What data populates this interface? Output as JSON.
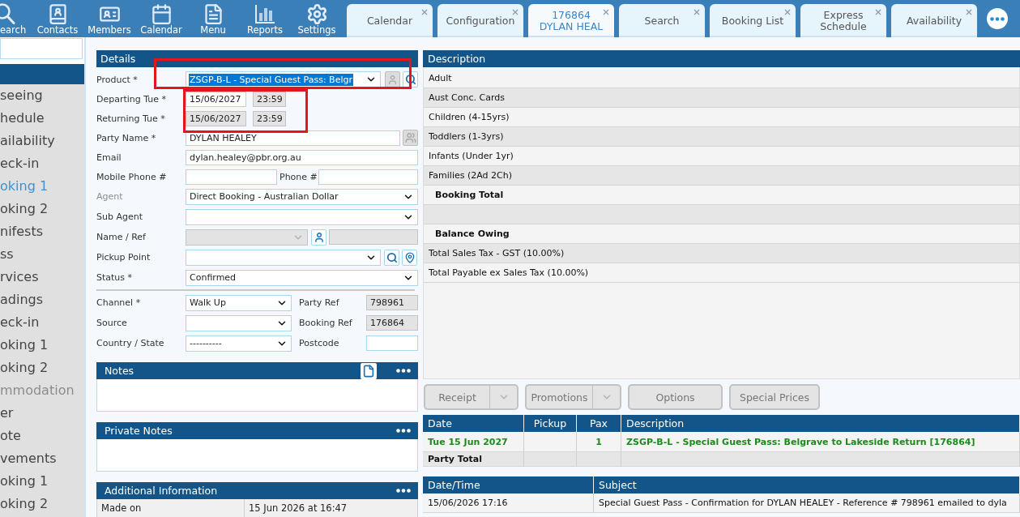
{
  "toolbar": [
    {
      "kind": "search",
      "label": "earch"
    },
    {
      "kind": "contacts",
      "label": "Contacts"
    },
    {
      "kind": "members",
      "label": "Members"
    },
    {
      "kind": "calendar",
      "label": "Calendar"
    },
    {
      "kind": "menu",
      "label": "Menu"
    },
    {
      "kind": "reports",
      "label": "Reports"
    },
    {
      "kind": "settings",
      "label": "Settings"
    }
  ],
  "tabs": [
    {
      "label": "Calendar",
      "selected": false
    },
    {
      "label": "Configuration",
      "selected": false
    },
    {
      "label": "176864 DYLAN HEAL",
      "selected": true
    },
    {
      "label": "Search",
      "selected": false
    },
    {
      "label": "Booking List",
      "selected": false
    },
    {
      "label": "Express Schedule",
      "selected": false
    },
    {
      "label": "Availability",
      "selected": false
    }
  ],
  "sidebar": {
    "items": [
      {
        "label": "seeing",
        "selected": false,
        "disabled": false
      },
      {
        "label": "hedule",
        "selected": false,
        "disabled": false
      },
      {
        "label": "ailability",
        "selected": false,
        "disabled": false
      },
      {
        "label": "eck-in",
        "selected": false,
        "disabled": false
      },
      {
        "label": "oking 1",
        "selected": true,
        "disabled": false
      },
      {
        "label": "oking 2",
        "selected": false,
        "disabled": false
      },
      {
        "label": "nifests",
        "selected": false,
        "disabled": false
      },
      {
        "label": "ss",
        "selected": false,
        "disabled": false
      },
      {
        "label": "rvices",
        "selected": false,
        "disabled": false
      },
      {
        "label": "adings",
        "selected": false,
        "disabled": false
      },
      {
        "label": "eck-in",
        "selected": false,
        "disabled": false
      },
      {
        "label": "oking 1",
        "selected": false,
        "disabled": false
      },
      {
        "label": "oking 2",
        "selected": false,
        "disabled": false
      },
      {
        "label": "mmodation",
        "selected": false,
        "disabled": true
      },
      {
        "label": "er",
        "selected": false,
        "disabled": false
      },
      {
        "label": "ote",
        "selected": false,
        "disabled": false
      },
      {
        "label": "vements",
        "selected": false,
        "disabled": false
      },
      {
        "label": "oking 1",
        "selected": false,
        "disabled": false
      },
      {
        "label": "oking 2",
        "selected": false,
        "disabled": false
      }
    ]
  },
  "details": {
    "title": "Details",
    "fields": [
      {
        "kind": "product",
        "label": "Product *",
        "value": "ZSGP-B-L - Special Guest Pass: Belgr",
        "highlighted": true,
        "outlined": true,
        "disabled": false
      },
      {
        "kind": "dates",
        "outlined": true,
        "disabled": false,
        "rows": [
          {
            "label": "Departing Tue *",
            "date": "15/06/2027",
            "time": "23:59",
            "disabled": false
          },
          {
            "label": "Returning Tue *",
            "date": "15/06/2027",
            "time": "23:59",
            "disabled": true
          }
        ]
      },
      {
        "kind": "party",
        "label": "Party Name *",
        "value": "DYLAN HEALEY",
        "disabled": false
      },
      {
        "kind": "text",
        "label": "Email",
        "value": "dylan.healey@pbr.org.au",
        "disabled": false
      },
      {
        "kind": "phones",
        "label": "Mobile Phone #",
        "label_2": "Phone #",
        "disabled": false
      },
      {
        "kind": "select",
        "label": "Agent",
        "value": "Direct Booking - Australian Dollar",
        "disabled": true
      },
      {
        "kind": "select",
        "label": "Sub Agent",
        "disabled": false
      },
      {
        "kind": "name_ref",
        "label": "Name / Ref",
        "disabled": false
      },
      {
        "kind": "pickup",
        "label": "Pickup Point",
        "disabled": false
      },
      {
        "kind": "select",
        "label": "Status *",
        "value": "Confirmed",
        "disabled": false
      }
    ],
    "extra_fields": [
      {
        "label": "Channel *",
        "value": "Walk Up",
        "label_2": "Party Ref",
        "value_2": "798961",
        "readonly": true
      },
      {
        "label": "Source",
        "label_2": "Booking Ref",
        "value_2": "176864",
        "readonly": true
      },
      {
        "label": "Country / State",
        "value": "----------",
        "label_2": "Postcode",
        "readonly": false
      }
    ]
  },
  "notes": {
    "title": "Notes"
  },
  "private_notes": {
    "title": "Private Notes"
  },
  "additional_information": {
    "title": "Additional Information",
    "rows": [
      {
        "label": "Made on",
        "value": "15 Jun 2026 at 16:47"
      }
    ]
  },
  "pricing": {
    "column": "Description",
    "rows": [
      {
        "kind": "line",
        "label": "Adult"
      },
      {
        "kind": "line",
        "label": "Aust Conc. Cards"
      },
      {
        "kind": "line",
        "label": "Children (4-15yrs)"
      },
      {
        "kind": "line",
        "label": "Toddlers (1-3yrs)"
      },
      {
        "kind": "line",
        "label": "Infants (Under 1yr)"
      },
      {
        "kind": "line",
        "label": "Families (2Ad 2Ch)"
      },
      {
        "kind": "total",
        "label": "Booking Total"
      },
      {
        "kind": "blank"
      },
      {
        "kind": "total",
        "label": "Balance Owing"
      },
      {
        "kind": "line",
        "label": "Total Sales Tax - GST (10.00%)"
      },
      {
        "kind": "line",
        "label": "Total Payable ex Sales Tax (10.00%)"
      }
    ]
  },
  "actions": [
    {
      "kind": "split",
      "label": "Receipt"
    },
    {
      "kind": "split",
      "label": "Promotions"
    },
    {
      "kind": "plain",
      "label": "Options"
    },
    {
      "kind": "plain",
      "label": "Special Prices"
    }
  ],
  "bookings": {
    "columns": [
      "Date",
      "Pickup",
      "Pax",
      "Description"
    ],
    "rows": [
      {
        "kind": "item",
        "date": "Tue 15 Jun 2027",
        "pax": "1",
        "description": "ZSGP-B-L - Special Guest Pass: Belgrave to Lakeside Return [176864]"
      },
      {
        "kind": "total",
        "label": "Party Total"
      }
    ]
  },
  "emails": {
    "columns": [
      "Date/Time",
      "Subject"
    ],
    "rows": [
      {
        "date": "15/06/2026 17:16",
        "subject": "Special Guest Pass - Confirmation for DYLAN HEALEY - Reference # 798961 emailed to dyla"
      }
    ]
  }
}
